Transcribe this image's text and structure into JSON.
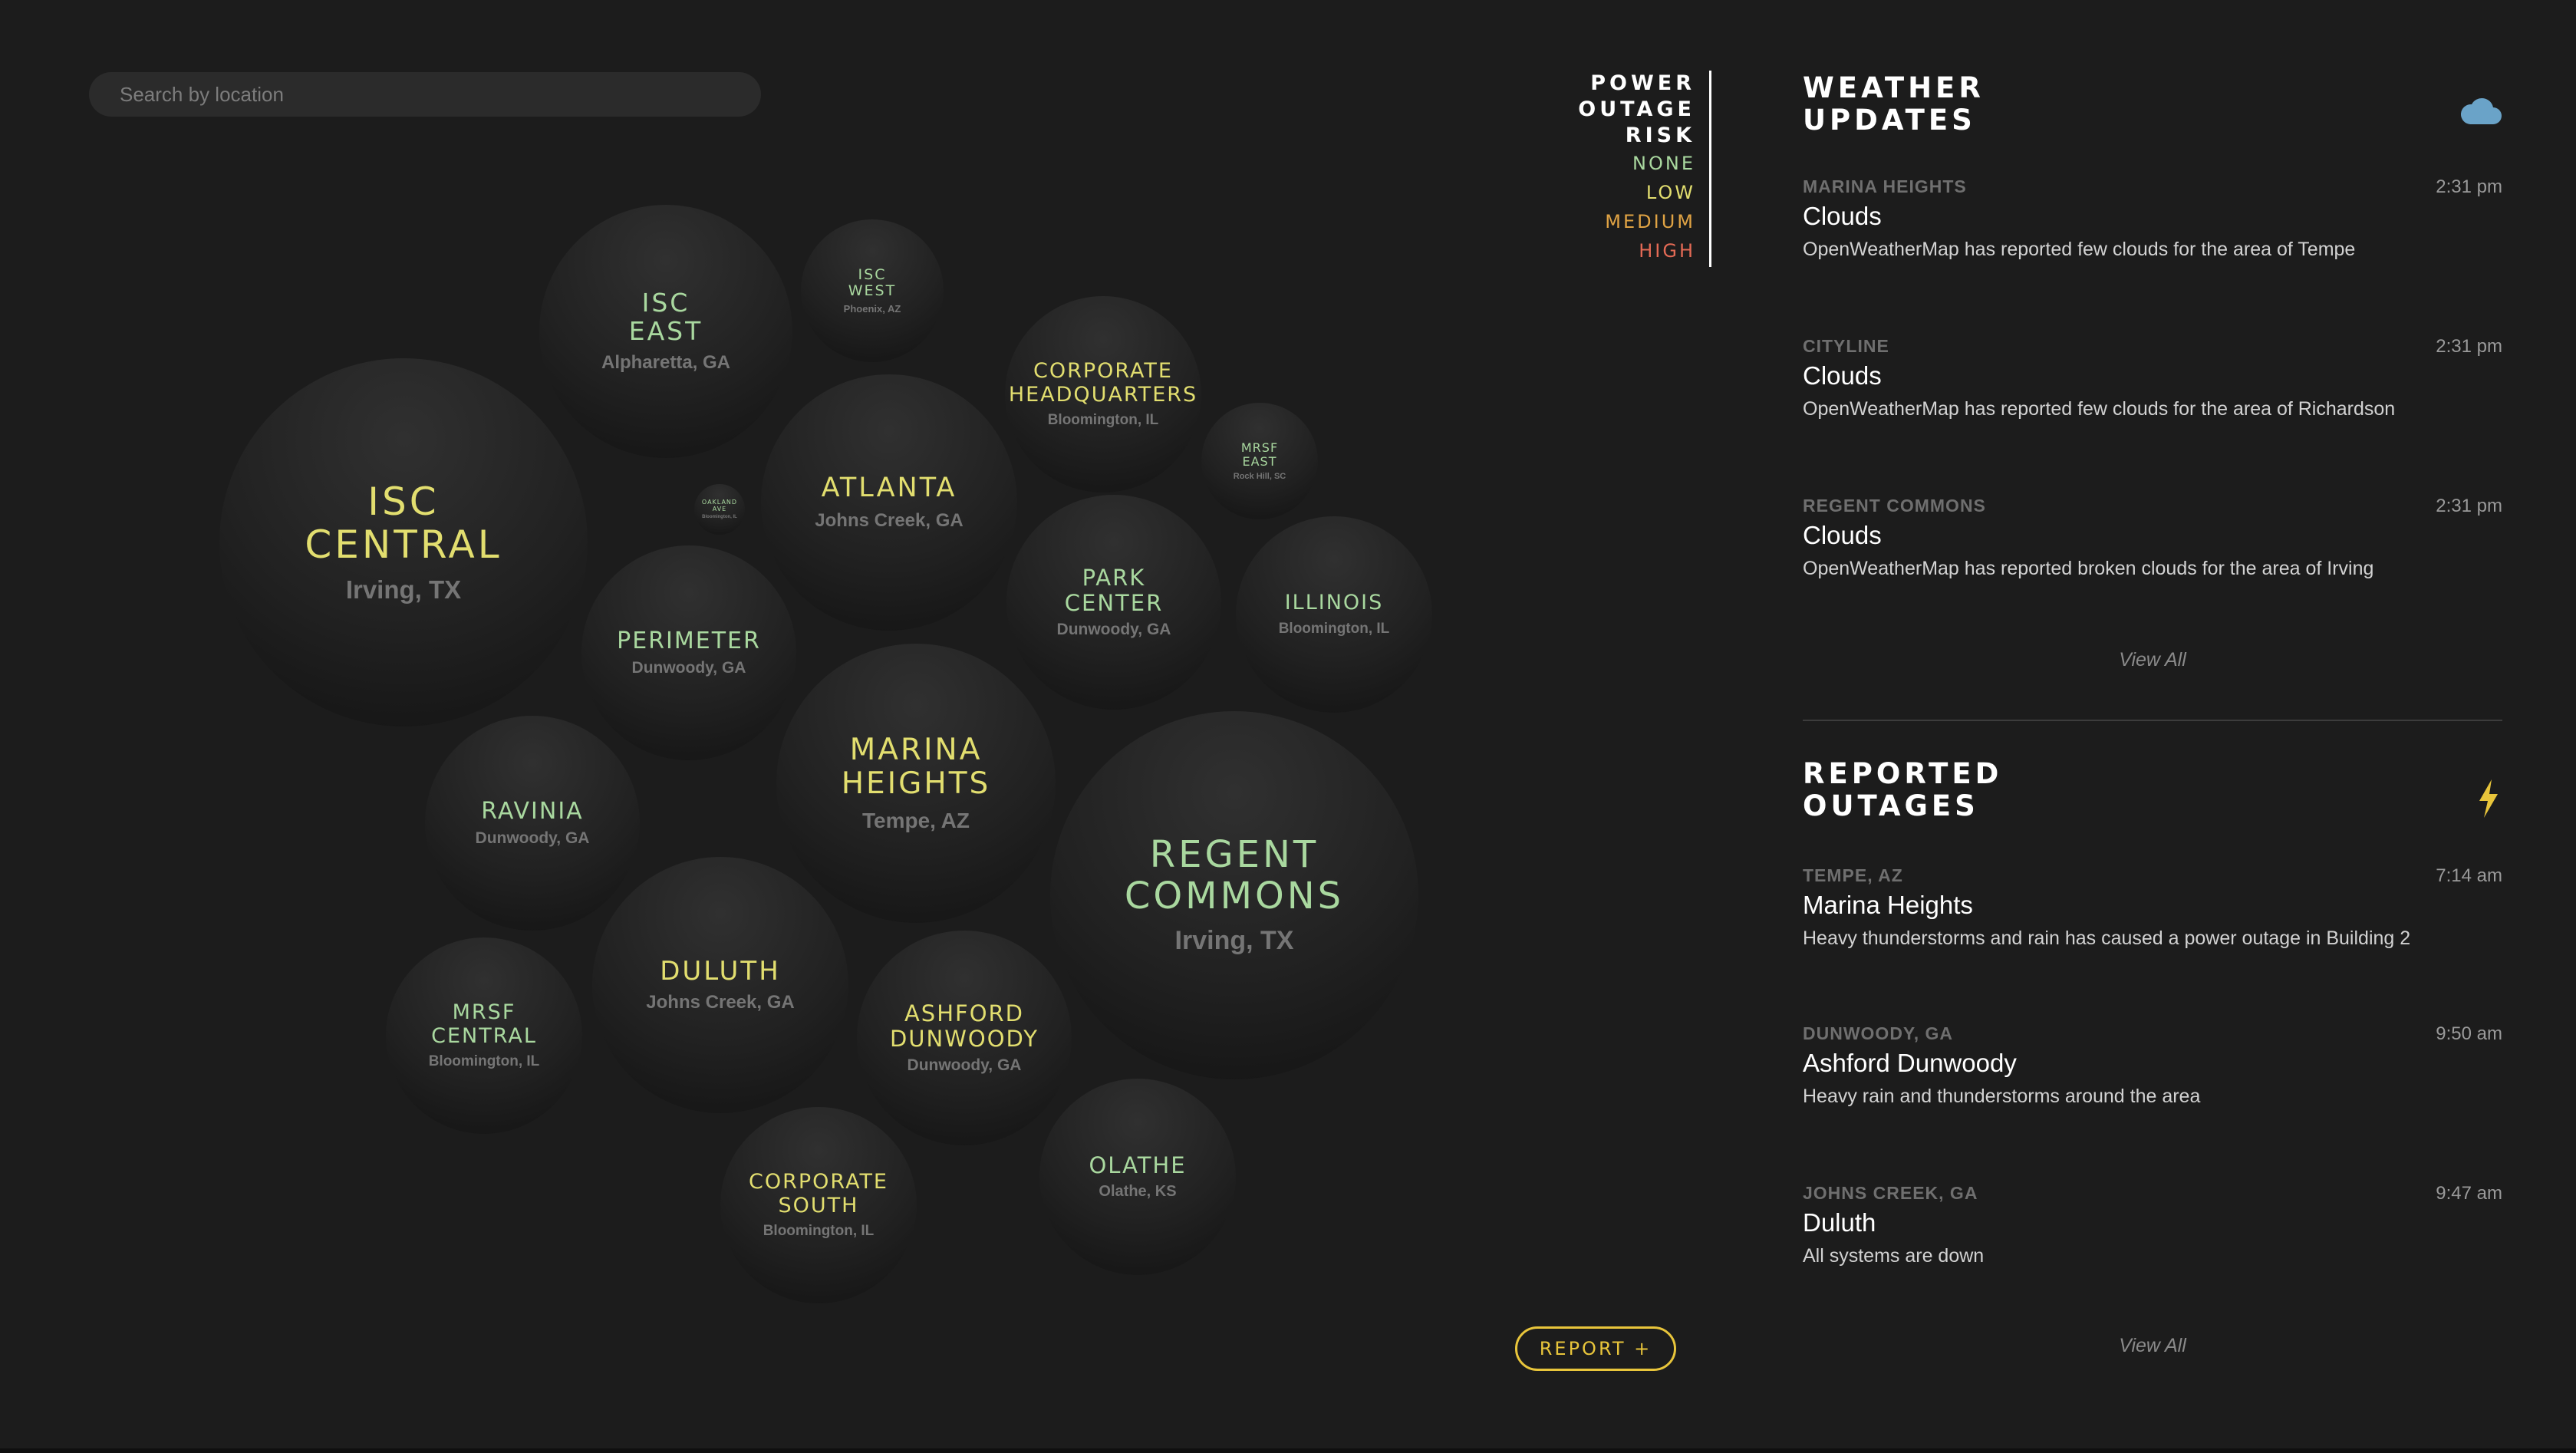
{
  "search": {
    "placeholder": "Search by location"
  },
  "colors": {
    "none": "#a9d89f",
    "low": "#e2de6f",
    "medium": "#e0a344",
    "high": "#e36a55",
    "accent": "#e8c53b",
    "background": "#1c1c1c"
  },
  "legend": {
    "title": "POWER\nOUTAGE\nRISK",
    "items": [
      {
        "label": "NONE",
        "level": "none"
      },
      {
        "label": "LOW",
        "level": "low"
      },
      {
        "label": "MEDIUM",
        "level": "medium"
      },
      {
        "label": "HIGH",
        "level": "high"
      }
    ]
  },
  "locations": [
    {
      "name": "ISC\nCENTRAL",
      "location": "Irving, TX",
      "risk": "low"
    },
    {
      "name": "ISC\nEAST",
      "location": "Alpharetta, GA",
      "risk": "none"
    },
    {
      "name": "ISC\nWEST",
      "location": "Phoenix, AZ",
      "risk": "none"
    },
    {
      "name": "CORPORATE\nHEADQUARTERS",
      "location": "Bloomington, IL",
      "risk": "low"
    },
    {
      "name": "MRSF\nEAST",
      "location": "Rock Hill, SC",
      "risk": "none"
    },
    {
      "name": "OAKLAND\nAVE",
      "location": "Bloomington, IL",
      "risk": "none"
    },
    {
      "name": "ATLANTA",
      "location": "Johns Creek, GA",
      "risk": "low"
    },
    {
      "name": "PARK\nCENTER",
      "location": "Dunwoody, GA",
      "risk": "none"
    },
    {
      "name": "ILLINOIS",
      "location": "Bloomington, IL",
      "risk": "none"
    },
    {
      "name": "PERIMETER",
      "location": "Dunwoody, GA",
      "risk": "none"
    },
    {
      "name": "MARINA\nHEIGHTS",
      "location": "Tempe, AZ",
      "risk": "low"
    },
    {
      "name": "RAVINIA",
      "location": "Dunwoody, GA",
      "risk": "none"
    },
    {
      "name": "REGENT\nCOMMONS",
      "location": "Irving, TX",
      "risk": "none"
    },
    {
      "name": "MRSF\nCENTRAL",
      "location": "Bloomington, IL",
      "risk": "none"
    },
    {
      "name": "DULUTH",
      "location": "Johns Creek, GA",
      "risk": "low"
    },
    {
      "name": "ASHFORD\nDUNWOODY",
      "location": "Dunwoody, GA",
      "risk": "low"
    },
    {
      "name": "CORPORATE\nSOUTH",
      "location": "Bloomington, IL",
      "risk": "low"
    },
    {
      "name": "OLATHE",
      "location": "Olathe, KS",
      "risk": "none"
    }
  ],
  "report_button": {
    "label": "REPORT +"
  },
  "weather": {
    "title": "WEATHER\nUPDATES",
    "icon": "cloud-icon",
    "icon_color": "#6aa3c8",
    "items": [
      {
        "kicker": "MARINA HEIGHTS",
        "time": "2:31 pm",
        "headline": "Clouds",
        "body": "OpenWeatherMap has reported few clouds for the area of Tempe"
      },
      {
        "kicker": "CITYLINE",
        "time": "2:31 pm",
        "headline": "Clouds",
        "body": "OpenWeatherMap has reported few clouds for the area of Richardson"
      },
      {
        "kicker": "REGENT COMMONS",
        "time": "2:31 pm",
        "headline": "Clouds",
        "body": "OpenWeatherMap has reported broken clouds for the area of Irving"
      }
    ],
    "view_all": "View All"
  },
  "outages": {
    "title": "REPORTED\nOUTAGES",
    "icon": "lightning-bolt-icon",
    "icon_color": "#e8c53b",
    "items": [
      {
        "kicker": "TEMPE, AZ",
        "time": "7:14 am",
        "headline": "Marina Heights",
        "body": "Heavy thunderstorms and rain has caused a power outage in Building 2"
      },
      {
        "kicker": "DUNWOODY, GA",
        "time": "9:50 am",
        "headline": "Ashford Dunwoody",
        "body": "Heavy rain and thunderstorms around the area"
      },
      {
        "kicker": "JOHNS CREEK, GA",
        "time": "9:47 am",
        "headline": "Duluth",
        "body": "All systems are down"
      }
    ],
    "view_all": "View All"
  }
}
